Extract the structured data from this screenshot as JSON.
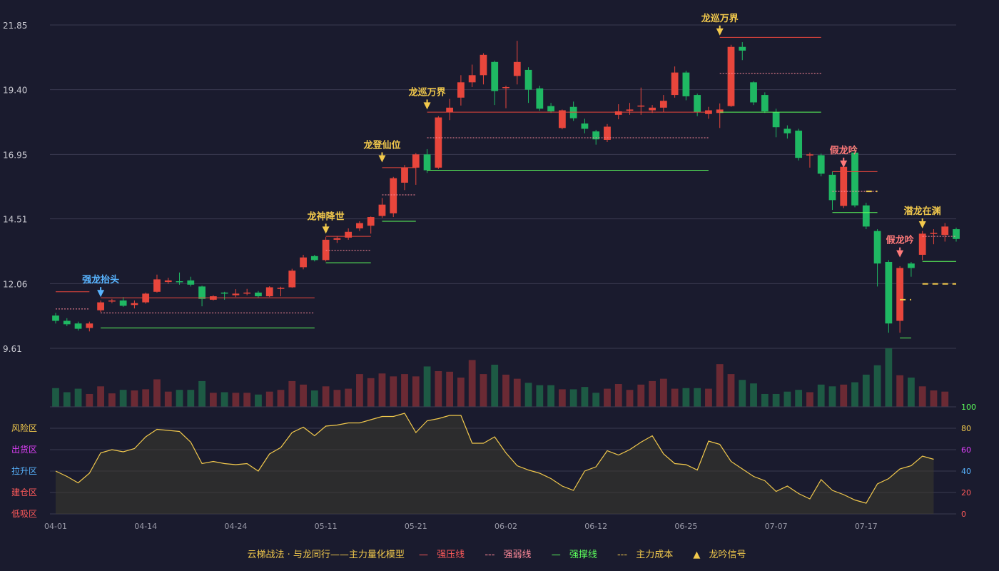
{
  "chart_data": {
    "type": "candlestick",
    "legend": [
      "云梯战法 · 与龙同行——主力量化模型",
      "强压线",
      "强弱线",
      "强撑线",
      "主力成本",
      "龙吟信号"
    ],
    "price_ticks": [
      "21.85",
      "19.40",
      "16.95",
      "14.51",
      "12.06",
      "9.61"
    ],
    "x_labels": [
      "04-01",
      "04-14",
      "04-24",
      "05-11",
      "05-21",
      "06-02",
      "06-12",
      "06-25",
      "07-07",
      "07-17"
    ],
    "x_label_index": [
      0,
      8,
      16,
      24,
      32,
      40,
      48,
      56,
      64,
      72
    ],
    "osc_right_ticks": [
      "100",
      "80",
      "60",
      "40",
      "20",
      "0"
    ],
    "osc_zones": [
      "风险区",
      "出货区",
      "拉升区",
      "建仓区",
      "低吸区"
    ],
    "colors": {
      "up": "#e8463c",
      "down": "#1fb863",
      "bg": "#1a1b2e",
      "grid": "#3a3b50",
      "gold": "#f2c94c",
      "blue": "#58b4ff",
      "pink": "#ff7a7a"
    },
    "candles": [
      [
        10.85,
        10.65,
        10.95,
        10.55
      ],
      [
        10.65,
        10.52,
        10.75,
        10.45
      ],
      [
        10.55,
        10.35,
        10.62,
        10.28
      ],
      [
        10.38,
        10.55,
        10.62,
        10.25
      ],
      [
        11.05,
        11.35,
        11.42,
        10.98
      ],
      [
        11.38,
        11.42,
        11.48,
        11.32
      ],
      [
        11.42,
        11.22,
        11.55,
        11.18
      ],
      [
        11.25,
        11.32,
        11.42,
        11.12
      ],
      [
        11.35,
        11.68,
        11.72,
        11.3
      ],
      [
        11.75,
        12.22,
        12.4,
        11.72
      ],
      [
        12.12,
        12.18,
        12.28,
        12.05
      ],
      [
        12.15,
        12.12,
        12.48,
        12.02
      ],
      [
        12.18,
        12.02,
        12.32,
        11.95
      ],
      [
        11.95,
        11.48,
        11.98,
        11.2
      ],
      [
        11.45,
        11.58,
        11.62,
        11.42
      ],
      [
        11.72,
        11.68,
        11.75,
        11.45
      ],
      [
        11.62,
        11.68,
        11.85,
        11.55
      ],
      [
        11.72,
        11.72,
        11.86,
        11.62
      ],
      [
        11.72,
        11.58,
        11.78,
        11.52
      ],
      [
        11.58,
        11.92,
        11.96,
        11.55
      ],
      [
        11.88,
        11.9,
        11.94,
        11.58
      ],
      [
        11.92,
        12.55,
        12.62,
        11.9
      ],
      [
        12.68,
        13.05,
        13.15,
        12.6
      ],
      [
        13.1,
        12.95,
        13.15,
        12.9
      ],
      [
        12.95,
        13.72,
        13.82,
        12.9
      ],
      [
        13.72,
        13.78,
        13.85,
        13.6
      ],
      [
        13.8,
        14.02,
        14.15,
        13.72
      ],
      [
        14.15,
        14.35,
        14.42,
        14.05
      ],
      [
        14.25,
        14.58,
        14.6,
        13.95
      ],
      [
        14.62,
        15.05,
        15.3,
        14.55
      ],
      [
        14.72,
        16.05,
        16.1,
        14.58
      ],
      [
        15.88,
        16.45,
        16.55,
        15.6
      ],
      [
        16.45,
        16.95,
        17.0,
        15.8
      ],
      [
        16.95,
        16.35,
        17.15,
        16.25
      ],
      [
        16.45,
        18.35,
        18.4,
        16.4
      ],
      [
        18.55,
        18.72,
        19.05,
        18.25
      ],
      [
        19.1,
        19.68,
        19.95,
        18.8
      ],
      [
        19.68,
        19.95,
        20.35,
        19.5
      ],
      [
        19.95,
        20.72,
        20.78,
        19.6
      ],
      [
        20.45,
        19.35,
        20.5,
        18.82
      ],
      [
        19.48,
        19.5,
        19.55,
        18.7
      ],
      [
        19.92,
        20.45,
        21.25,
        19.6
      ],
      [
        20.15,
        19.4,
        20.25,
        18.9
      ],
      [
        19.45,
        18.68,
        19.55,
        18.6
      ],
      [
        18.78,
        18.58,
        18.9,
        18.52
      ],
      [
        17.95,
        18.62,
        18.65,
        17.9
      ],
      [
        18.75,
        18.32,
        18.95,
        18.22
      ],
      [
        18.12,
        17.92,
        18.3,
        17.75
      ],
      [
        17.82,
        17.52,
        17.88,
        17.32
      ],
      [
        17.5,
        18.0,
        18.1,
        17.42
      ],
      [
        18.45,
        18.58,
        18.85,
        18.28
      ],
      [
        18.6,
        18.65,
        18.9,
        18.45
      ],
      [
        18.78,
        18.8,
        19.48,
        18.45
      ],
      [
        18.62,
        18.72,
        18.82,
        18.52
      ],
      [
        18.72,
        18.98,
        19.2,
        18.55
      ],
      [
        19.2,
        20.05,
        20.28,
        19.1
      ],
      [
        20.05,
        19.15,
        20.12,
        19.0
      ],
      [
        19.2,
        18.55,
        19.25,
        18.4
      ],
      [
        18.48,
        18.62,
        18.75,
        18.3
      ],
      [
        18.52,
        18.65,
        18.88,
        17.95
      ],
      [
        18.78,
        21.02,
        21.1,
        18.75
      ],
      [
        21.02,
        20.88,
        21.2,
        20.52
      ],
      [
        19.68,
        18.92,
        19.72,
        18.82
      ],
      [
        19.2,
        18.58,
        19.3,
        18.52
      ],
      [
        18.55,
        17.98,
        18.68,
        17.6
      ],
      [
        17.92,
        17.75,
        18.05,
        17.55
      ],
      [
        17.85,
        16.82,
        17.92,
        16.72
      ],
      [
        16.95,
        16.95,
        17.02,
        16.45
      ],
      [
        16.92,
        16.22,
        16.98,
        16.12
      ],
      [
        16.18,
        15.22,
        16.3,
        14.85
      ],
      [
        15.0,
        16.48,
        16.52,
        14.92
      ],
      [
        17.02,
        15.02,
        17.25,
        14.95
      ],
      [
        15.02,
        14.22,
        15.12,
        14.12
      ],
      [
        14.05,
        12.82,
        14.12,
        11.95
      ],
      [
        12.88,
        10.55,
        12.95,
        10.2
      ],
      [
        10.65,
        12.65,
        12.72,
        10.2
      ],
      [
        12.82,
        12.65,
        12.88,
        12.32
      ],
      [
        13.15,
        13.95,
        14.05,
        12.95
      ],
      [
        13.98,
        13.98,
        14.12,
        13.55
      ],
      [
        13.9,
        14.22,
        14.35,
        13.65
      ],
      [
        14.12,
        13.75,
        14.18,
        13.65
      ]
    ],
    "volume": [
      32,
      25,
      31,
      22,
      35,
      23,
      29,
      28,
      30,
      47,
      26,
      29,
      29,
      44,
      24,
      25,
      24,
      24,
      21,
      26,
      29,
      44,
      38,
      28,
      35,
      29,
      31,
      56,
      49,
      57,
      52,
      56,
      52,
      69,
      61,
      60,
      50,
      80,
      56,
      72,
      55,
      48,
      41,
      37,
      37,
      30,
      30,
      34,
      24,
      31,
      39,
      29,
      38,
      44,
      48,
      31,
      32,
      32,
      31,
      73,
      56,
      46,
      40,
      22,
      22,
      26,
      29,
      25,
      38,
      35,
      38,
      42,
      55,
      71,
      100,
      54,
      50,
      35,
      28,
      26
    ],
    "oscillator": [
      40,
      35,
      29,
      38,
      57,
      60,
      58,
      61,
      72,
      79,
      78,
      77,
      67,
      47,
      49,
      47,
      46,
      47,
      40,
      56,
      62,
      76,
      81,
      73,
      82,
      83,
      85,
      85,
      88,
      91,
      91,
      94,
      76,
      87,
      89,
      92,
      92,
      66,
      66,
      72,
      57,
      45,
      41,
      38,
      33,
      26,
      22,
      40,
      44,
      59,
      55,
      60,
      67,
      73,
      56,
      47,
      46,
      41,
      68,
      65,
      49,
      42,
      35,
      31,
      21,
      26,
      19,
      14,
      32,
      22,
      18,
      13,
      10,
      28,
      33,
      42,
      45,
      54,
      51
    ]
  }
}
